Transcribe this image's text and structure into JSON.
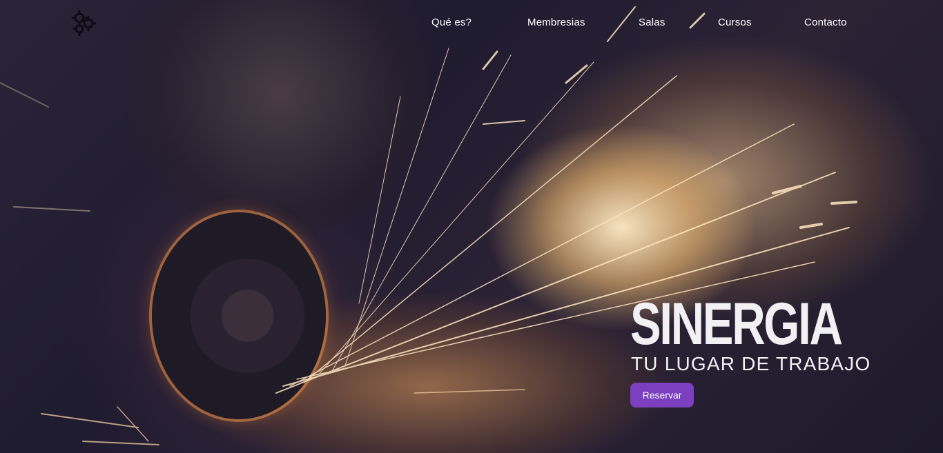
{
  "nav": {
    "logo_icon": "gears-icon",
    "links": [
      "Qué es?",
      "Membresias",
      "Salas",
      "Cursos",
      "Contacto"
    ]
  },
  "hero": {
    "title": "SINERGIA",
    "subtitle": "TU LUGAR DE TRABAJO",
    "cta_label": "Reservar",
    "background": "photo of angle grinder cutting metal with sparks"
  },
  "colors": {
    "accent": "#7b3fc0",
    "text": "#f1f1f4",
    "background_dark": "#1c1a2e"
  }
}
